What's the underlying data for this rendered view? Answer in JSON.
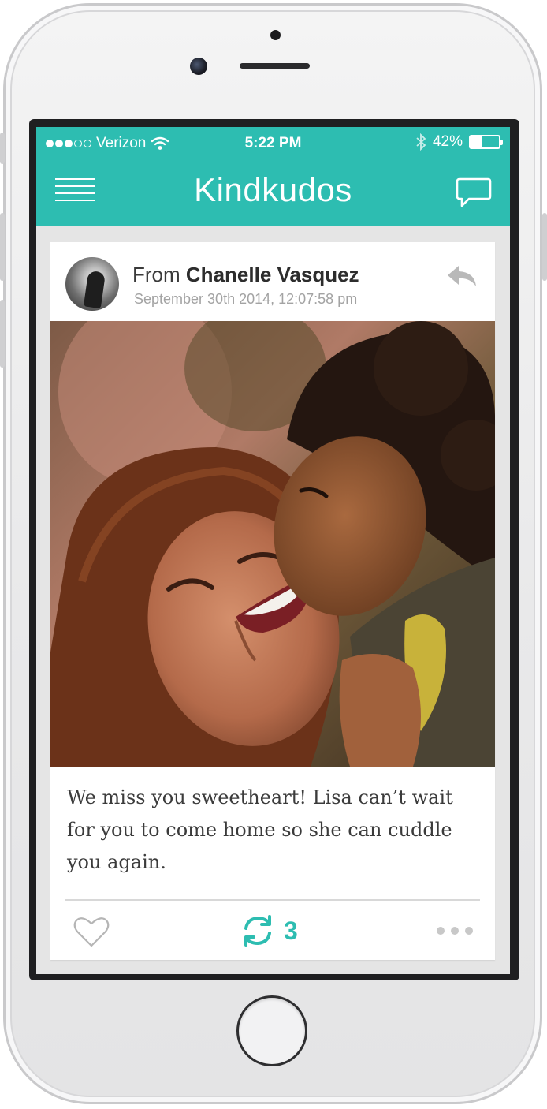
{
  "status_bar": {
    "carrier": "Verizon",
    "time": "5:22 PM",
    "battery_percent": "42%",
    "battery_level": 0.42,
    "signal_bars_filled": 3,
    "signal_bars_total": 5
  },
  "app": {
    "title": "Kindkudos",
    "accent_color": "#2dbdb1"
  },
  "post": {
    "from_prefix": "From",
    "sender_name": "Chanelle Vasquez",
    "timestamp": "September 30th 2014, 12:07:58 pm",
    "message": "We miss you sweetheart! Lisa can’t wait for you to come home so she can cuddle you again.",
    "share_count": "3",
    "icons": {
      "menu": "hamburger-menu-icon",
      "chat": "chat-bubble-icon",
      "reply": "reply-arrow-icon",
      "like": "heart-icon",
      "share": "refresh-share-icon",
      "more": "more-dots-icon"
    }
  }
}
